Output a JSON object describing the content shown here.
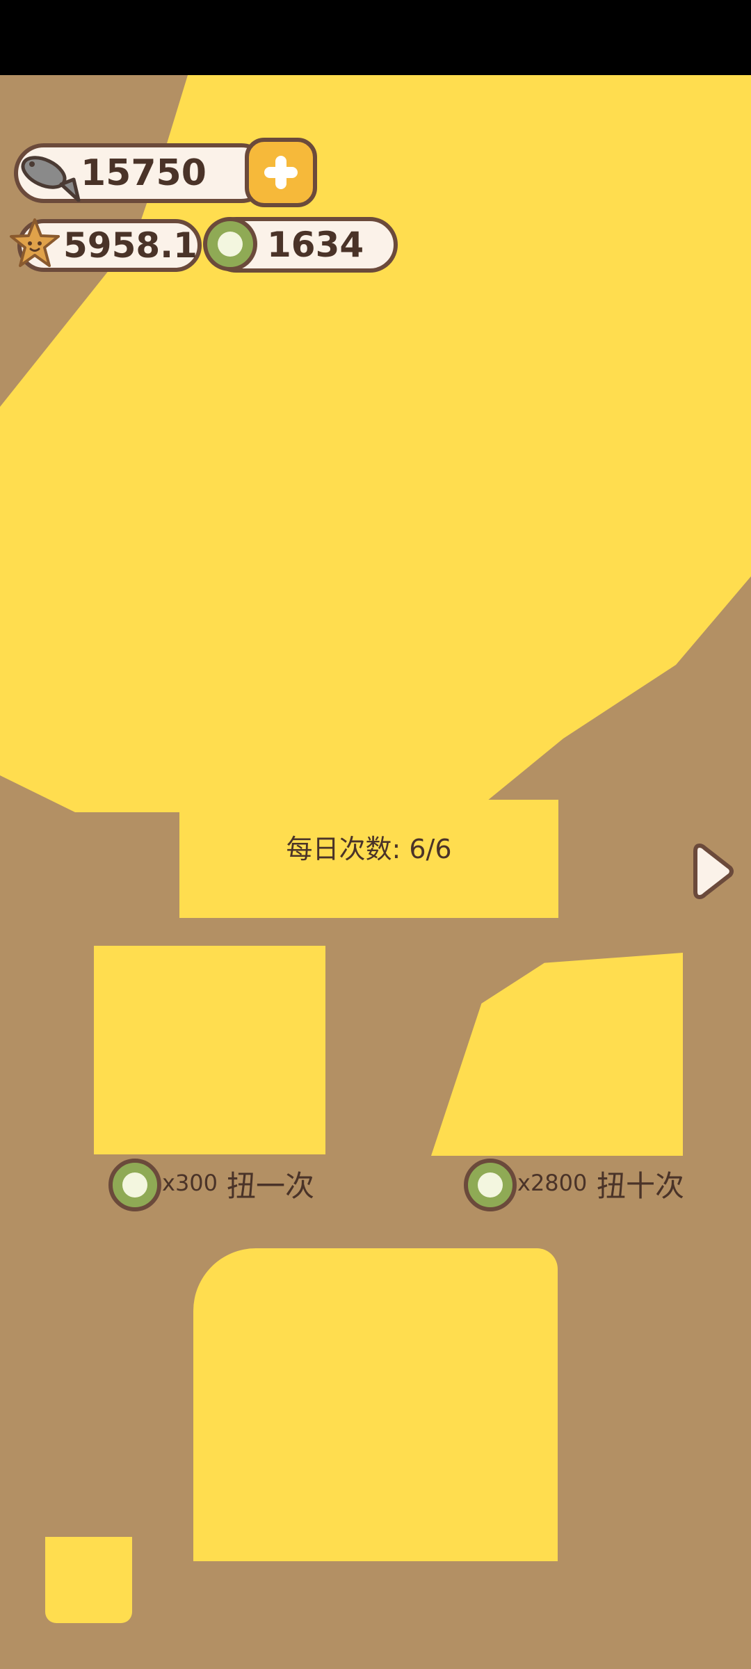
{
  "currencies": {
    "fish": "15750",
    "star": "5958.1",
    "coin": "1634"
  },
  "daily": {
    "label": "每日次数",
    "value": ": 6/6"
  },
  "gacha": {
    "once": {
      "cost": "x300",
      "label": "扭一次"
    },
    "ten": {
      "cost": "x2800",
      "label": "扭十次"
    }
  },
  "icons": {
    "fish": "fish-icon",
    "star": "star-icon",
    "coin": "coin-icon",
    "plus": "plus-icon",
    "next": "chevron-right-icon"
  },
  "colors": {
    "background": "#b39064",
    "highlight": "#ffdd4f",
    "outline": "#6b4a3b",
    "pill": "#fbf2e9",
    "plus_button": "#f6b93a",
    "coin": "#8faa55"
  }
}
